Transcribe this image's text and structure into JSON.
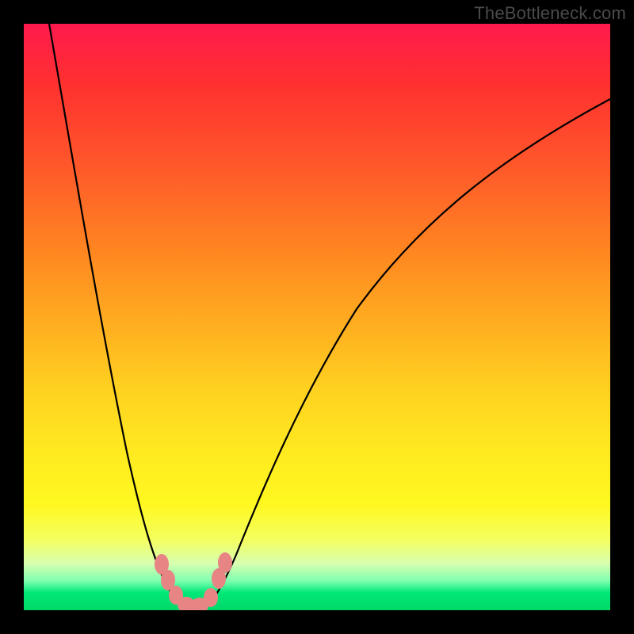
{
  "watermark": "TheBottleneck.com",
  "colors": {
    "top": "#ff1a4d",
    "mid": "#ffd020",
    "bottom_green": "#00d868",
    "curve": "#000000",
    "beads": "#e78585",
    "frame": "#000000"
  },
  "chart_data": {
    "type": "line",
    "title": "",
    "xlabel": "",
    "ylabel": "",
    "xlim": [
      0,
      100
    ],
    "ylim": [
      0,
      100
    ],
    "note": "V-shaped bottleneck curve; minimum near x≈27. Axes unlabeled; values below are pixel-read estimates (0–100 scale) of the black curve height.",
    "x": [
      5,
      10,
      15,
      20,
      22,
      24,
      26,
      27,
      28,
      30,
      32,
      35,
      40,
      50,
      60,
      70,
      80,
      90,
      100
    ],
    "y": [
      100,
      80,
      55,
      25,
      14,
      6,
      1,
      0,
      1,
      5,
      12,
      22,
      35,
      55,
      68,
      77,
      83,
      87,
      90
    ],
    "beads": [
      {
        "x": 22.5,
        "y": 12
      },
      {
        "x": 24.0,
        "y": 6
      },
      {
        "x": 25.5,
        "y": 2
      },
      {
        "x": 27.0,
        "y": 0
      },
      {
        "x": 28.5,
        "y": 0
      },
      {
        "x": 30.0,
        "y": 2
      },
      {
        "x": 31.0,
        "y": 8
      },
      {
        "x": 32.0,
        "y": 14
      }
    ]
  }
}
